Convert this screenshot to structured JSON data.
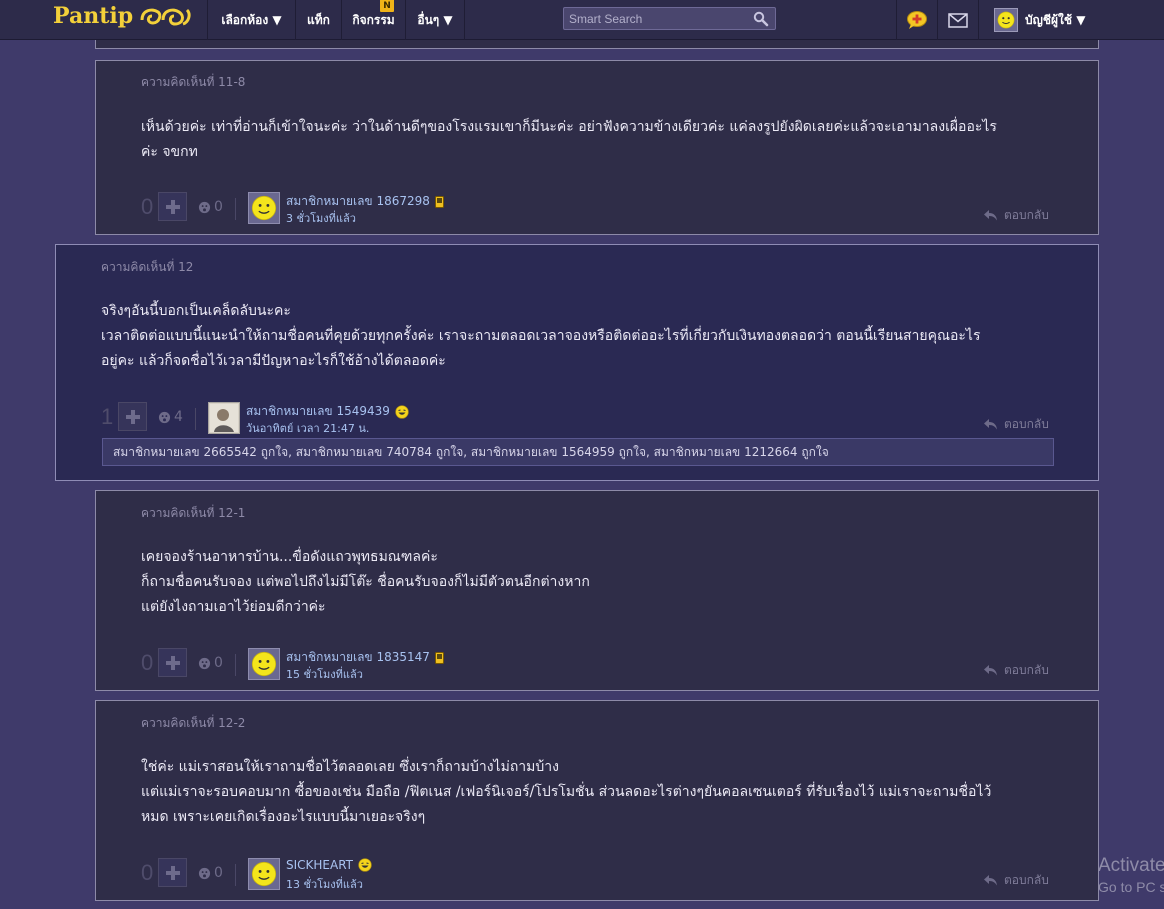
{
  "nav": {
    "logo_text": "Pantip",
    "items": [
      {
        "label": "เลือกห้อง ▼"
      },
      {
        "label": "แท็ก"
      },
      {
        "label": "กิจกรรม",
        "badge": "N"
      },
      {
        "label": "อื่นๆ ▼"
      }
    ],
    "search_placeholder": "Smart Search",
    "account_label": "บัญชีผู้ใช้ ▼"
  },
  "reply_label": "ตอบกลับ",
  "comments": [
    {
      "label": "ความคิดเห็นที่ 11-8",
      "body": [
        "เห็นด้วยค่ะ เท่าที่อ่านก็เข้าใจนะค่ะ ว่าในด้านดีๆของโรงแรมเขาก็มีนะค่ะ อย่าฟังความข้างเดียวค่ะ แค่ลงรูปยังผิดเลยค่ะแล้วจะเอามาลงเผื่ออะไร",
        "ค่ะ จขกท"
      ],
      "score": "0",
      "emotions": "0",
      "user": "สมาชิกหมายเลข 1867298",
      "time": "3 ชั่วโมงที่แล้ว"
    },
    {
      "label": "ความคิดเห็นที่ 12",
      "body": [
        "จริงๆอันนี้บอกเป็นเคล็ดลับนะคะ",
        "เวลาติดต่อแบบนี้แนะนำให้ถามชื่อคนที่คุยด้วยทุกครั้งค่ะ เราจะถามตลอดเวลาจองหรือติดต่ออะไรที่เกี่ยวกับเงินทองตลอดว่า ตอนนี้เรียนสายคุณอะไร",
        "อยู่คะ แล้วก็จดชื่อไว้เวลามีปัญหาอะไรก็ใช้อ้างได้ตลอดค่ะ"
      ],
      "score": "1",
      "emotions": "4",
      "user": "สมาชิกหมายเลข 1549439",
      "time": "วันอาทิตย์ เวลา 21:47 น.",
      "likes": "สมาชิกหมายเลข 2665542 ถูกใจ, สมาชิกหมายเลข 740784 ถูกใจ, สมาชิกหมายเลข 1564959 ถูกใจ, สมาชิกหมายเลข 1212664 ถูกใจ"
    },
    {
      "label": "ความคิดเห็นที่ 12-1",
      "body": [
        "เคยจองร้านอาหารบ้าน...ขื่อดังแถวพุทธมณฑลค่ะ",
        "ก็ถามชื่อคนรับจอง แต่พอไปถึงไม่มีโต๊ะ ชื่อคนรับจองก็ไม่มีตัวตนอีกต่างหาก",
        "แต่ยังไงถามเอาไว้ย่อมดีกว่าค่ะ"
      ],
      "score": "0",
      "emotions": "0",
      "user": "สมาชิกหมายเลข 1835147",
      "time": "15 ชั่วโมงที่แล้ว"
    },
    {
      "label": "ความคิดเห็นที่ 12-2",
      "body": [
        "ใช่ค่ะ แม่เราสอนให้เราถามชื่อไว้ตลอดเลย ซึ่งเราก็ถามบ้างไม่ถามบ้าง",
        "แต่แม่เราจะรอบคอบมาก ซื้อของเช่น มือถือ /ฟิตเนส /เฟอร์นิเจอร์/โปรโมชั่น ส่วนลดอะไรต่างๆยันคอลเซนเตอร์ ที่รับเรื่องไว้ แม่เราจะถามชื่อไว้",
        "หมด เพราะเคยเกิดเรื่องอะไรแบบนี้มาเยอะจริงๆ"
      ],
      "score": "0",
      "emotions": "0",
      "user": "SICKHEART",
      "time": "13 ชั่วโมงที่แล้ว"
    }
  ],
  "watermark": {
    "line1": "Activate",
    "line2": "Go to PC s"
  }
}
